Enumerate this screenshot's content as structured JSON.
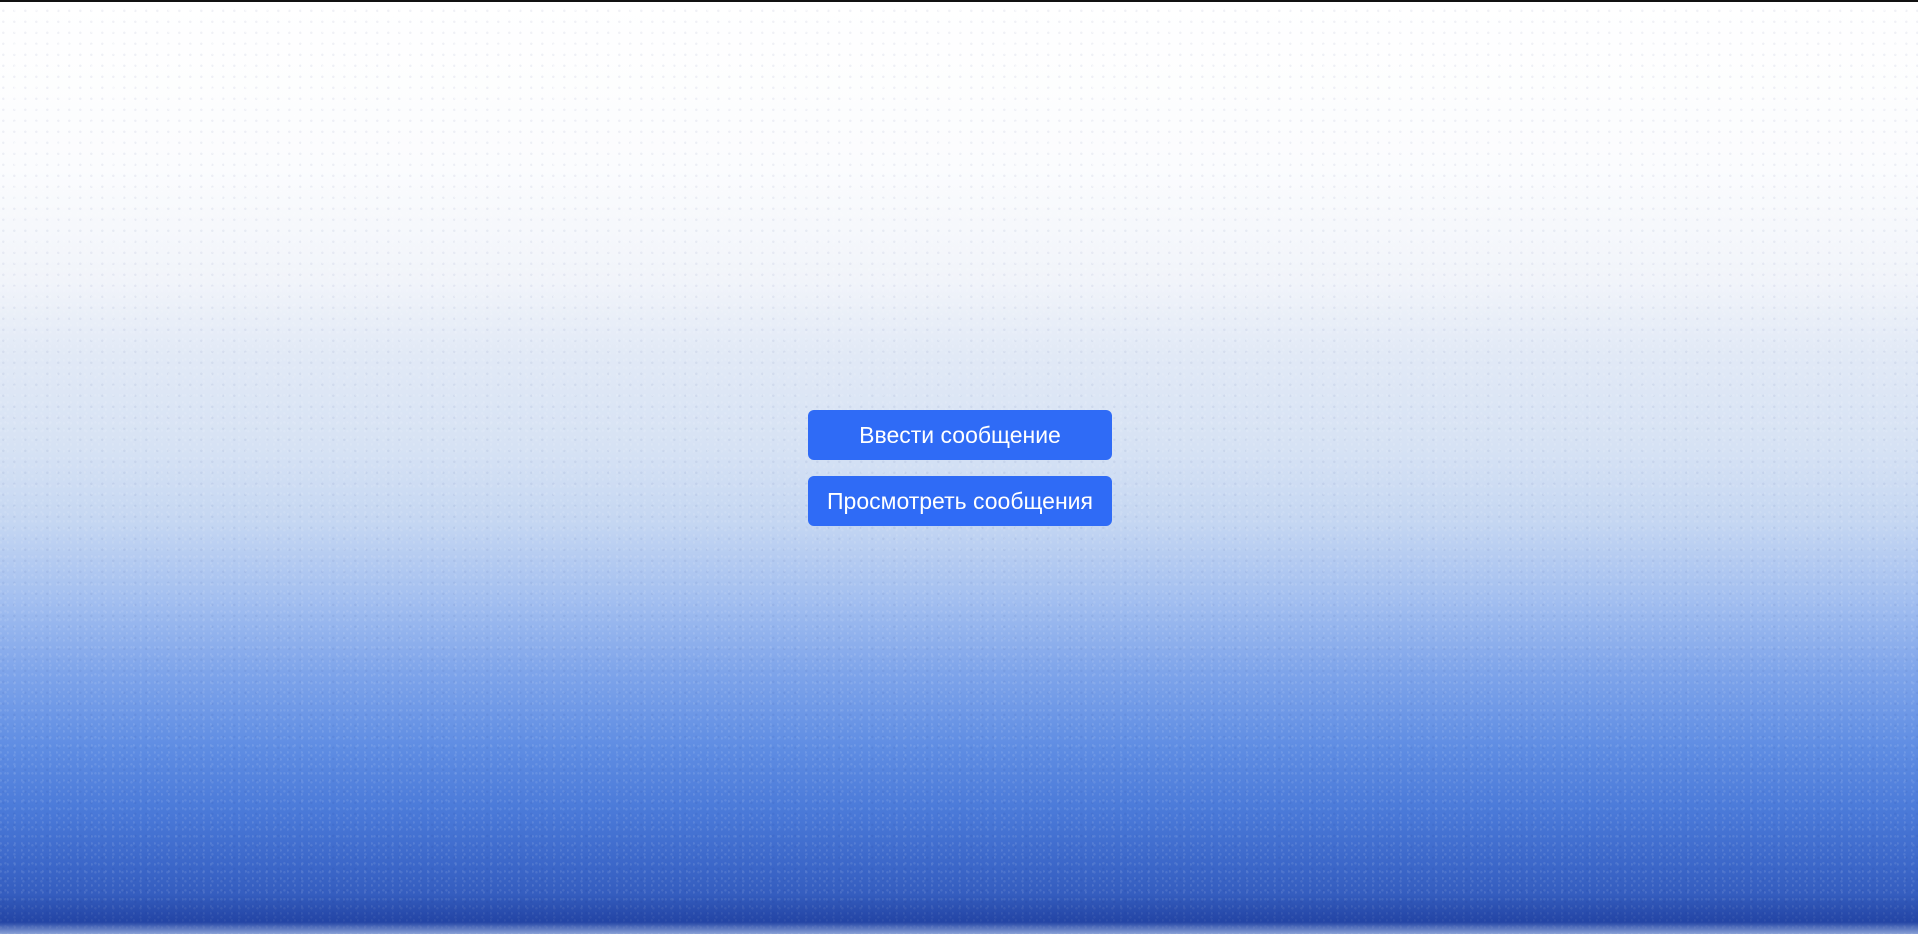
{
  "colors": {
    "button_bg": "#2f6bf6",
    "button_text": "#ffffff",
    "background_top": "#ffffff",
    "background_bottom": "#2b4fb0"
  },
  "actions": {
    "enter_message_label": "Ввести сообщение",
    "view_messages_label": "Просмотреть сообщения"
  }
}
